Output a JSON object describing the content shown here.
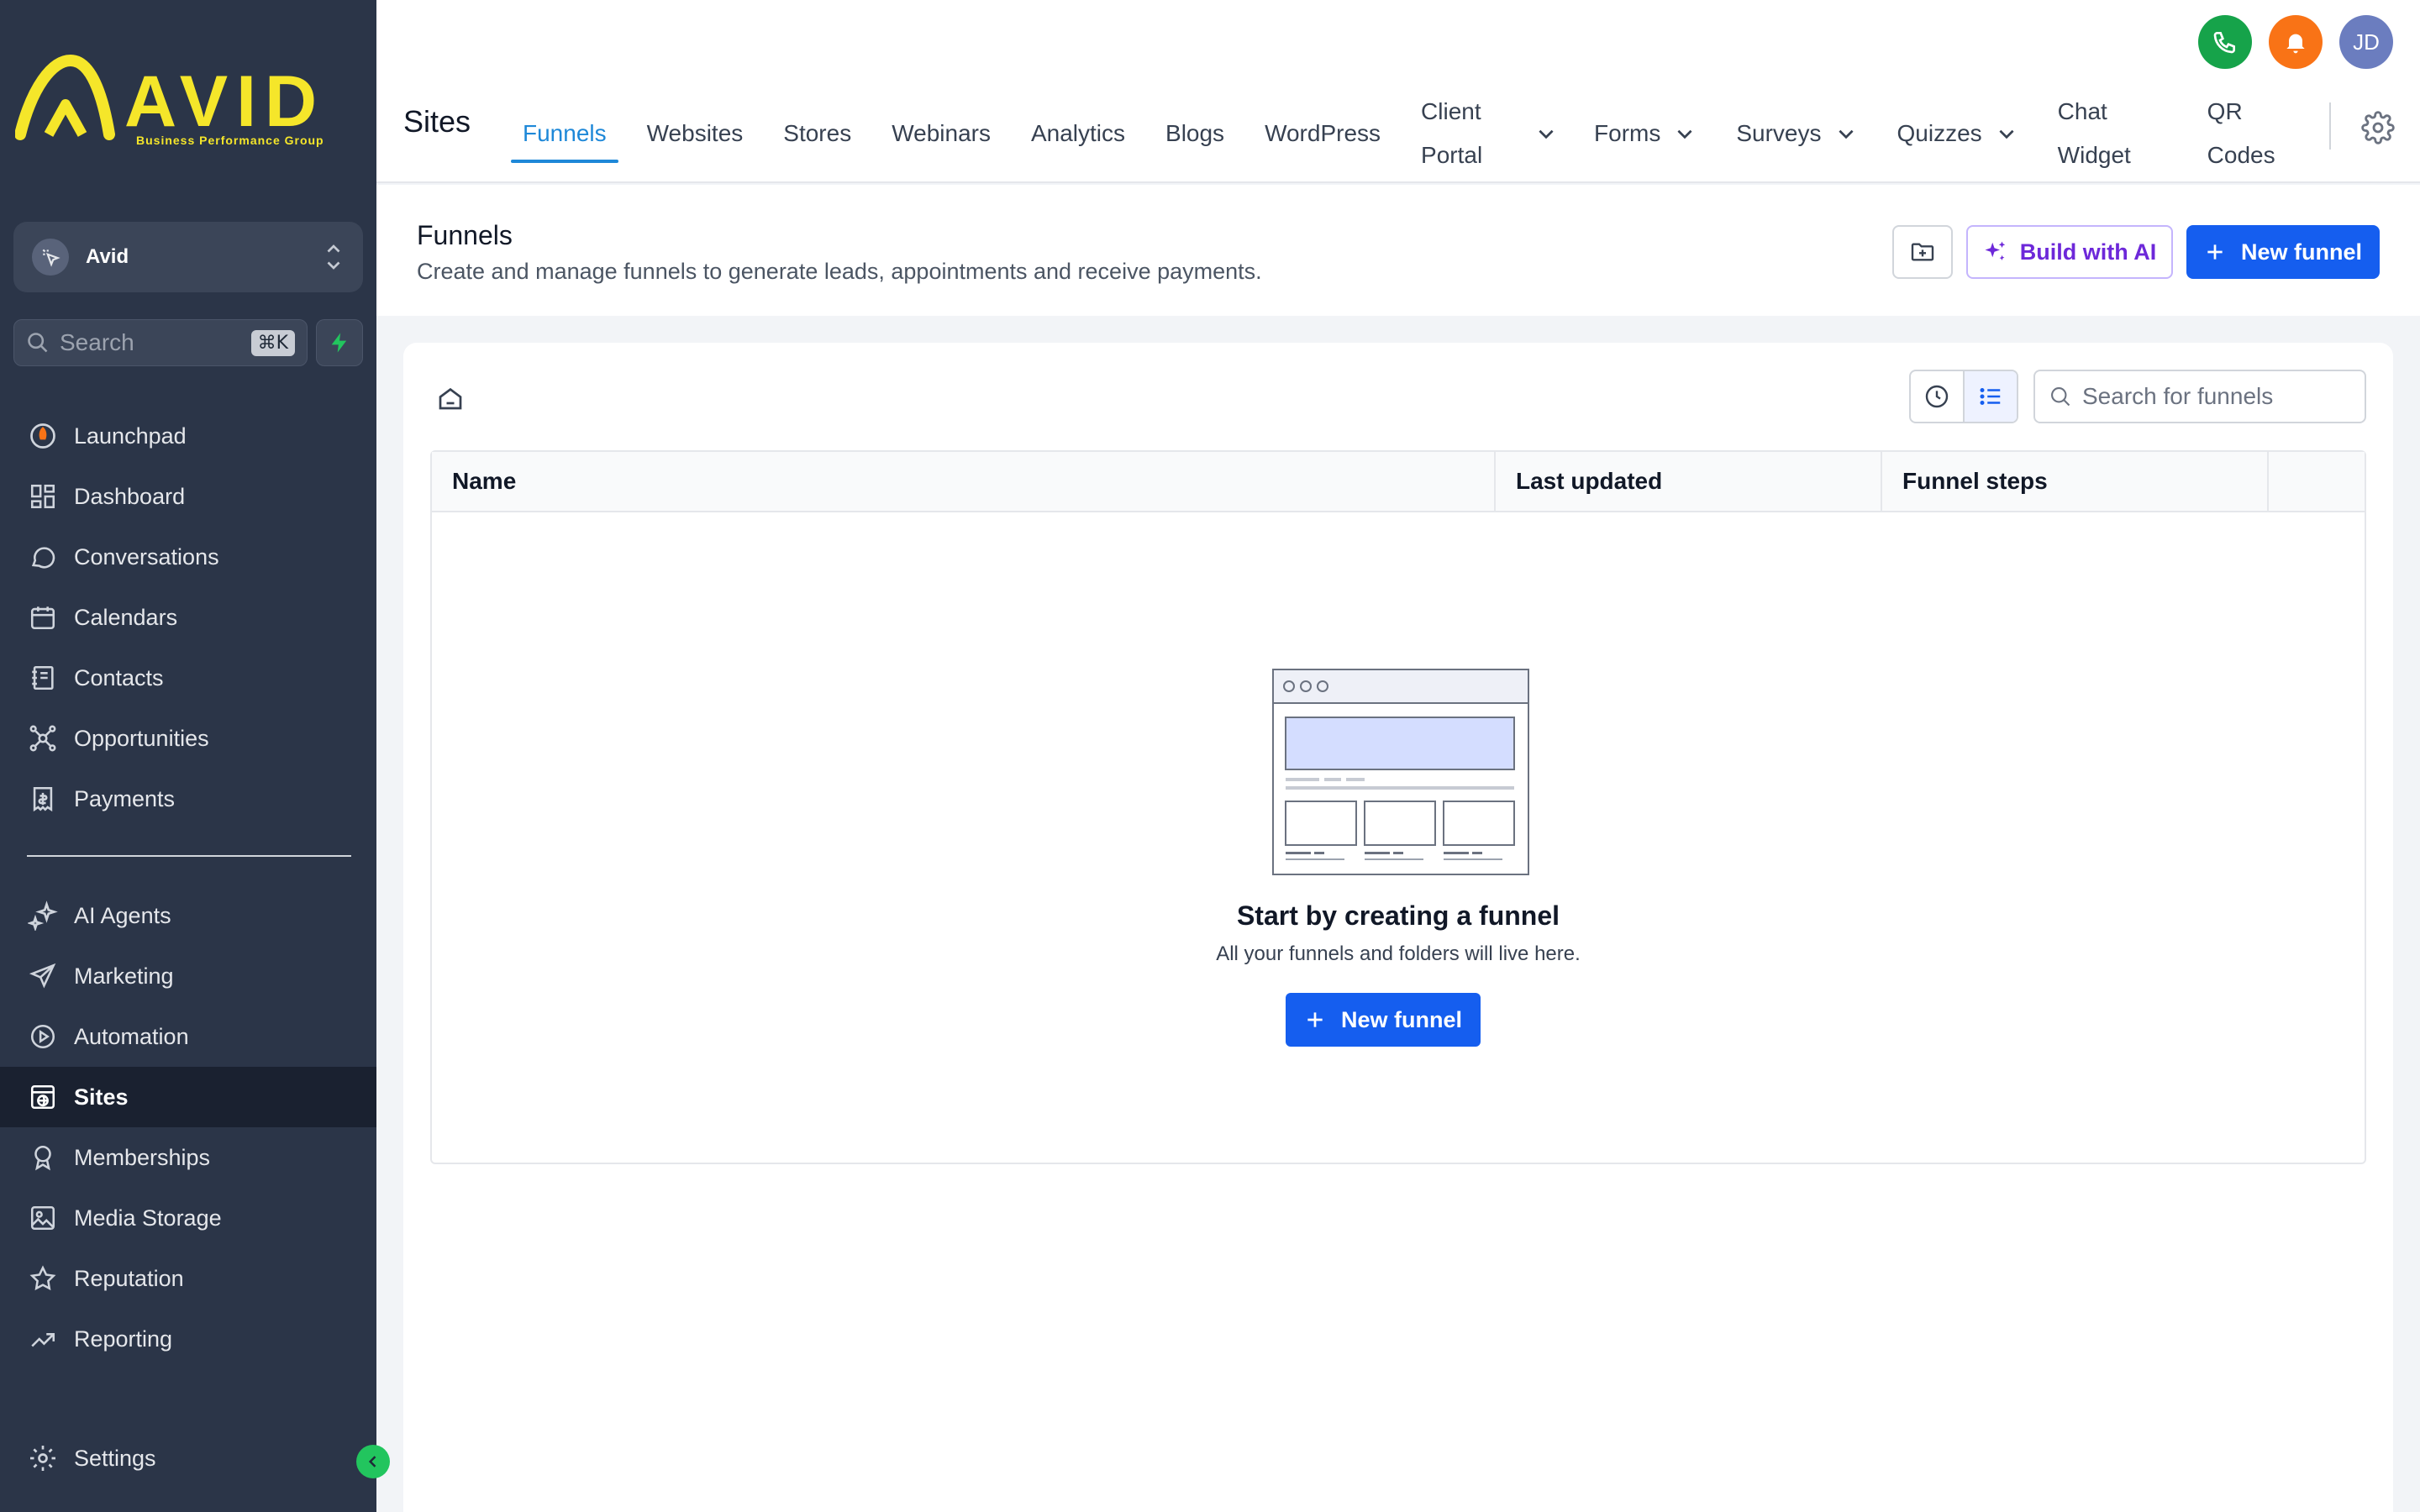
{
  "brand": {
    "logo_text": "AVID",
    "tagline": "Business Performance Group",
    "logo_color": "#f5e62a"
  },
  "account": {
    "name": "Avid"
  },
  "sidebar_search": {
    "placeholder": "Search",
    "shortcut": "⌘K"
  },
  "sidebar": {
    "primary": [
      {
        "label": "Launchpad",
        "icon": "rocket-icon"
      },
      {
        "label": "Dashboard",
        "icon": "grid-icon"
      },
      {
        "label": "Conversations",
        "icon": "chat-bubble-icon"
      },
      {
        "label": "Calendars",
        "icon": "calendar-icon"
      },
      {
        "label": "Contacts",
        "icon": "contact-book-icon"
      },
      {
        "label": "Opportunities",
        "icon": "network-icon"
      },
      {
        "label": "Payments",
        "icon": "receipt-icon"
      }
    ],
    "secondary": [
      {
        "label": "AI Agents",
        "icon": "sparkle-icon"
      },
      {
        "label": "Marketing",
        "icon": "send-icon"
      },
      {
        "label": "Automation",
        "icon": "play-circle-icon"
      },
      {
        "label": "Sites",
        "icon": "globe-window-icon",
        "active": true
      },
      {
        "label": "Memberships",
        "icon": "badge-icon"
      },
      {
        "label": "Media Storage",
        "icon": "image-icon"
      },
      {
        "label": "Reputation",
        "icon": "star-icon"
      },
      {
        "label": "Reporting",
        "icon": "trend-icon"
      }
    ],
    "settings": {
      "label": "Settings",
      "icon": "gear-icon"
    }
  },
  "topbar": {
    "title": "Sites",
    "tabs": [
      {
        "label": "Funnels",
        "active": true
      },
      {
        "label": "Websites"
      },
      {
        "label": "Stores"
      },
      {
        "label": "Webinars"
      },
      {
        "label": "Analytics"
      },
      {
        "label": "Blogs"
      },
      {
        "label": "WordPress"
      },
      {
        "label": "Client Portal",
        "line1": "Client",
        "line2": "Portal",
        "dropdown": true
      },
      {
        "label": "Forms",
        "dropdown": true
      },
      {
        "label": "Surveys",
        "dropdown": true
      },
      {
        "label": "Quizzes",
        "dropdown": true
      },
      {
        "label": "Chat Widget",
        "line1": "Chat",
        "line2": "Widget"
      },
      {
        "label": "QR Codes",
        "line1": "QR",
        "line2": "Codes"
      }
    ],
    "user_initials": "JD",
    "colors": {
      "phone": "#16a34a",
      "bell": "#f97316",
      "avatar": "#6b7dbf",
      "accent": "#1e88d8"
    }
  },
  "header": {
    "title": "Funnels",
    "description": "Create and manage funnels to generate leads, appointments and receive payments.",
    "build_ai_label": "Build with AI",
    "new_funnel_label": "New funnel"
  },
  "list": {
    "search_placeholder": "Search for funnels",
    "columns": [
      "Name",
      "Last updated",
      "Funnel steps",
      ""
    ]
  },
  "empty_state": {
    "title": "Start by creating a funnel",
    "description": "All your funnels and folders will live here.",
    "button_label": "New funnel"
  }
}
